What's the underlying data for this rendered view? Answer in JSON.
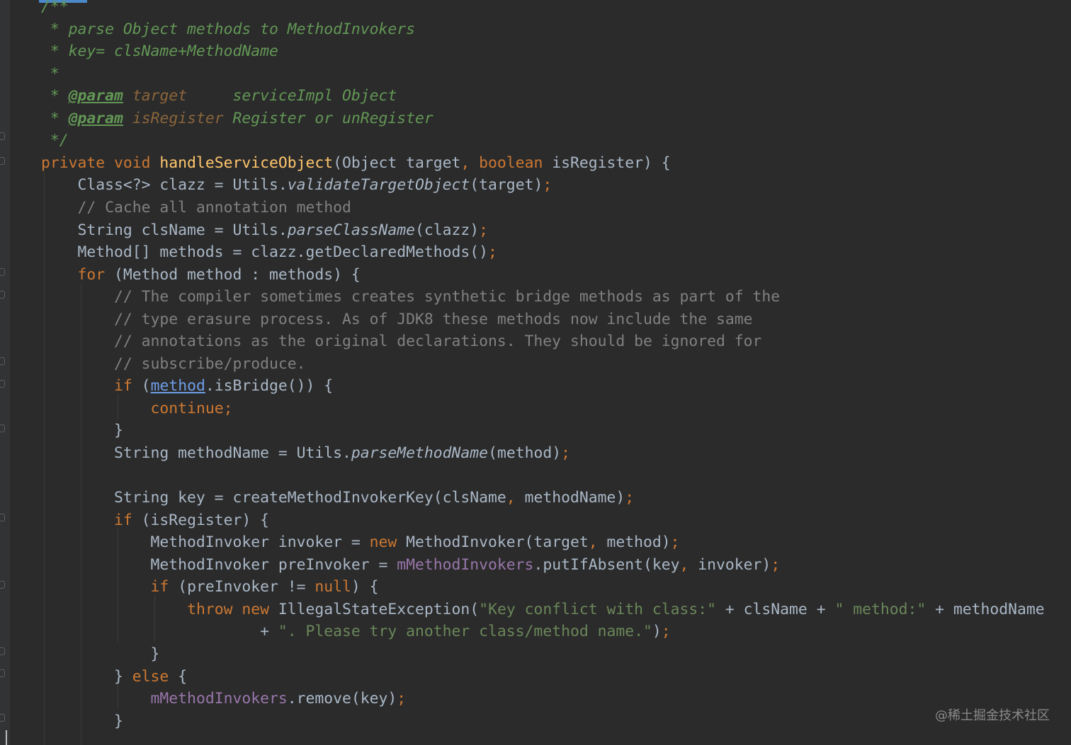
{
  "editor": {
    "lines": [
      [
        {
          "t": "/**",
          "s": "c-doc"
        }
      ],
      [
        {
          "t": " * parse Object methods to MethodInvokers",
          "s": "c-doc"
        }
      ],
      [
        {
          "t": " * key= clsName+MethodName",
          "s": "c-doc"
        }
      ],
      [
        {
          "t": " *",
          "s": "c-doc"
        }
      ],
      [
        {
          "t": " * ",
          "s": "c-doc"
        },
        {
          "t": "@param",
          "s": "c-tag"
        },
        {
          "t": " ",
          "s": "c-doc"
        },
        {
          "t": "target",
          "s": "c-pname"
        },
        {
          "t": "     serviceImpl Object",
          "s": "c-doc"
        }
      ],
      [
        {
          "t": " * ",
          "s": "c-doc"
        },
        {
          "t": "@param",
          "s": "c-tag"
        },
        {
          "t": " ",
          "s": "c-doc"
        },
        {
          "t": "isRegister",
          "s": "c-pname"
        },
        {
          "t": " Register or unRegister",
          "s": "c-doc"
        }
      ],
      [
        {
          "t": " */",
          "s": "c-doc"
        }
      ],
      [
        {
          "t": "private void ",
          "s": "c-kw"
        },
        {
          "t": "handleServiceObject",
          "s": "c-fn"
        },
        {
          "t": "(Object target"
        },
        {
          "t": ", ",
          "s": "c-kw"
        },
        {
          "t": "boolean ",
          "s": "c-kw"
        },
        {
          "t": "isRegister) {"
        }
      ],
      [
        {
          "t": "    Class<?> clazz = Utils."
        },
        {
          "t": "validateTargetObject",
          "s": "c-static"
        },
        {
          "t": "(target)"
        },
        {
          "t": ";",
          "s": "c-kw"
        }
      ],
      [
        {
          "t": "    // Cache all annotation method",
          "s": "c-line"
        }
      ],
      [
        {
          "t": "    String clsName = Utils."
        },
        {
          "t": "parseClassName",
          "s": "c-static"
        },
        {
          "t": "(clazz)"
        },
        {
          "t": ";",
          "s": "c-kw"
        }
      ],
      [
        {
          "t": "    Method[] methods = clazz.getDeclaredMethods()"
        },
        {
          "t": ";",
          "s": "c-kw"
        }
      ],
      [
        {
          "t": "    "
        },
        {
          "t": "for ",
          "s": "c-kw"
        },
        {
          "t": "(Method method : methods) {"
        }
      ],
      [
        {
          "t": "        // The compiler sometimes creates synthetic bridge methods as part of the",
          "s": "c-line"
        }
      ],
      [
        {
          "t": "        // type erasure process. As of JDK8 these methods now include the same",
          "s": "c-line"
        }
      ],
      [
        {
          "t": "        // annotations as the original declarations. They should be ignored for",
          "s": "c-line"
        }
      ],
      [
        {
          "t": "        // subscribe/produce.",
          "s": "c-line"
        }
      ],
      [
        {
          "t": "        "
        },
        {
          "t": "if ",
          "s": "c-kw"
        },
        {
          "t": "("
        },
        {
          "t": "method",
          "s": "c-link"
        },
        {
          "t": ".isBridge()) {"
        }
      ],
      [
        {
          "t": "            "
        },
        {
          "t": "continue;",
          "s": "c-kw"
        }
      ],
      [
        {
          "t": "        }"
        }
      ],
      [
        {
          "t": "        String methodName = Utils."
        },
        {
          "t": "parseMethodName",
          "s": "c-static"
        },
        {
          "t": "(method)"
        },
        {
          "t": ";",
          "s": "c-kw"
        }
      ],
      [
        {
          "t": ""
        }
      ],
      [
        {
          "t": "        String key = createMethodInvokerKey(clsName"
        },
        {
          "t": ", ",
          "s": "c-kw"
        },
        {
          "t": "methodName)"
        },
        {
          "t": ";",
          "s": "c-kw"
        }
      ],
      [
        {
          "t": "        "
        },
        {
          "t": "if ",
          "s": "c-kw"
        },
        {
          "t": "(isRegister) {"
        }
      ],
      [
        {
          "t": "            MethodInvoker invoker = "
        },
        {
          "t": "new ",
          "s": "c-kw"
        },
        {
          "t": "MethodInvoker(target"
        },
        {
          "t": ", ",
          "s": "c-kw"
        },
        {
          "t": "method)"
        },
        {
          "t": ";",
          "s": "c-kw"
        }
      ],
      [
        {
          "t": "            MethodInvoker preInvoker = "
        },
        {
          "t": "mMethodInvokers",
          "s": "c-field"
        },
        {
          "t": ".putIfAbsent(key"
        },
        {
          "t": ", ",
          "s": "c-kw"
        },
        {
          "t": "invoker)"
        },
        {
          "t": ";",
          "s": "c-kw"
        }
      ],
      [
        {
          "t": "            "
        },
        {
          "t": "if ",
          "s": "c-kw"
        },
        {
          "t": "(preInvoker != "
        },
        {
          "t": "null",
          "s": "c-kw"
        },
        {
          "t": ") {"
        }
      ],
      [
        {
          "t": "                "
        },
        {
          "t": "throw new ",
          "s": "c-kw"
        },
        {
          "t": "IllegalStateException("
        },
        {
          "t": "\"Key conflict with class:\"",
          "s": "c-str"
        },
        {
          "t": " + clsName + "
        },
        {
          "t": "\" method:\"",
          "s": "c-str"
        },
        {
          "t": " + methodName"
        }
      ],
      [
        {
          "t": "                        + "
        },
        {
          "t": "\". Please try another class/method name.\"",
          "s": "c-str"
        },
        {
          "t": ")"
        },
        {
          "t": ";",
          "s": "c-kw"
        }
      ],
      [
        {
          "t": "            }"
        }
      ],
      [
        {
          "t": "        } "
        },
        {
          "t": "else ",
          "s": "c-kw"
        },
        {
          "t": "{"
        }
      ],
      [
        {
          "t": "            "
        },
        {
          "t": "mMethodInvokers",
          "s": "c-field"
        },
        {
          "t": ".remove(key)"
        },
        {
          "t": ";",
          "s": "c-kw"
        }
      ],
      [
        {
          "t": "        }"
        }
      ]
    ]
  },
  "watermark": "@稀土掘金技术社区"
}
